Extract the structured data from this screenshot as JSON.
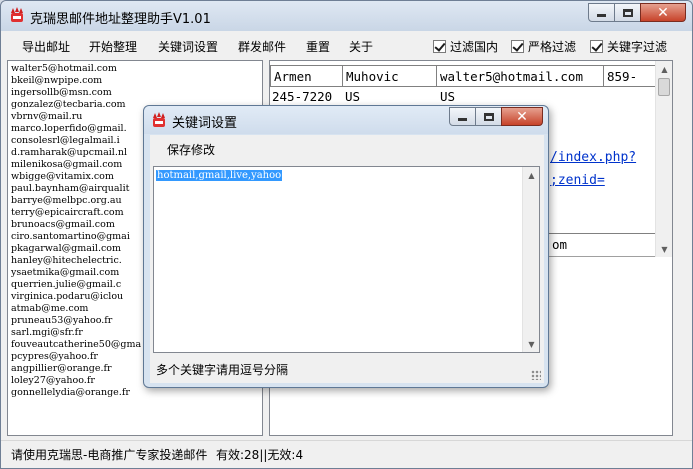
{
  "window": {
    "title": "克瑞思邮件地址整理助手V1.01",
    "icon": "app-logo-icon"
  },
  "menu": {
    "export": "导出邮址",
    "start": "开始整理",
    "keywords": "关键词设置",
    "mass_mail": "群发邮件",
    "reset": "重置",
    "about": "关于"
  },
  "options": {
    "filter_domestic": {
      "label": "过滤国内",
      "checked": true
    },
    "strict_filter": {
      "label": "严格过滤",
      "checked": true
    },
    "keyword_filter": {
      "label": "关键字过滤",
      "checked": true
    }
  },
  "emails": [
    "walter5@hotmail.com",
    "bkeil@nwpipe.com",
    "ingersollb@msn.com",
    "gonzalez@tecbaria.com",
    "vbrnv@mail.ru",
    "marco.loperfido@gmail.",
    "consolesrl@legalmail.i",
    "d.ramharak@upcmail.nl",
    "milenikosa@gmail.com",
    "wbigge@vitamix.com",
    "paul.baynham@airqualit",
    "barrye@melbpc.org.au",
    "terry@epicaircraft.com",
    "brunoacs@gmail.com",
    "ciro.santomartino@gmai",
    "pkagarwal@gmail.com",
    "hanley@hitechelectric.",
    "ysaetmika@gmail.com",
    "querrien.julie@gmail.c",
    "virginica.podaru@iclou",
    "atmab@me.com",
    "pruneau53@yahoo.fr",
    "sarl.mgi@sfr.fr",
    "fouveautcatherine50@gma",
    "pcypres@yahoo.fr",
    "angpillier@orange.fr",
    "loley27@yahoo.fr",
    "gonnellelydia@orange.fr"
  ],
  "record": {
    "first_name": "Armen",
    "last_name": "Muhovic",
    "email": "walter5@hotmail.com",
    "phone_start": "859-",
    "phone_end": "245-7220",
    "country1": "US",
    "country2": "US",
    "link1": "/index.php?",
    "link2": ";zenid=",
    "tail": "om"
  },
  "status": {
    "text": "请使用克瑞思-电商推广专家投递邮件",
    "counts": "有效:28||无效:4"
  },
  "dialog": {
    "title": "关键词设置",
    "save_label": "保存修改",
    "keywords_value": "hotmail,gmail,live,yahoo",
    "hint": "多个关键字请用逗号分隔"
  },
  "colors": {
    "title_bar": "#cfdcec",
    "close_button": "#c7432a",
    "selection": "#3399ff",
    "link": "#0033cc"
  }
}
